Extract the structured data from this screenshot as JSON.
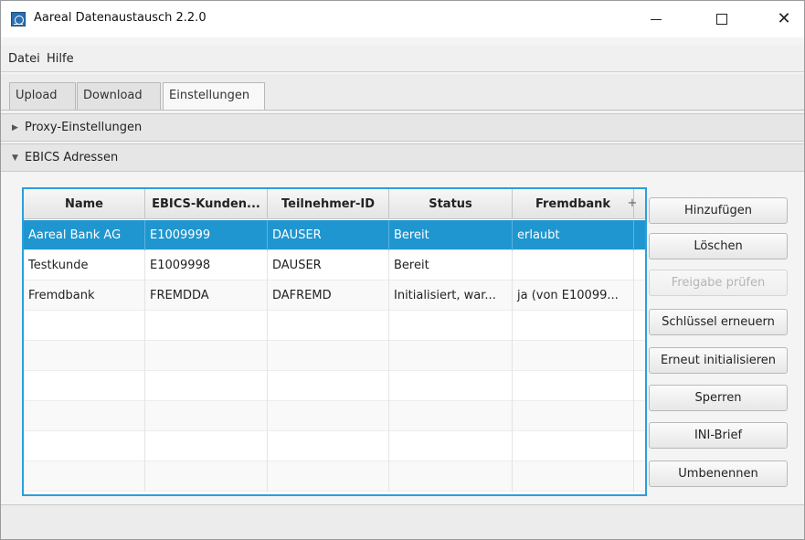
{
  "window": {
    "title": "Aareal Datenaustausch 2.2.0",
    "minimize_glyph": "",
    "maximize_glyph": "",
    "close_glyph": "✕"
  },
  "menu": {
    "items": [
      "Datei",
      "Hilfe"
    ]
  },
  "tabs": [
    {
      "label": "Upload",
      "active": false
    },
    {
      "label": "Download",
      "active": false
    },
    {
      "label": "Einstellungen",
      "active": true
    }
  ],
  "panes": {
    "proxy": {
      "label": "Proxy-Einstellungen",
      "arrow": "▶",
      "expanded": false
    },
    "ebics": {
      "label": "EBICS Adressen",
      "arrow": "▼",
      "expanded": true
    }
  },
  "table": {
    "columns": [
      "Name",
      "EBICS-Kunden...",
      "Teilnehmer-ID",
      "Status",
      "Fremdbank"
    ],
    "add_column_glyph": "+",
    "rows": [
      [
        "Aareal Bank AG",
        "E1009999",
        "DAUSER",
        "Bereit",
        "erlaubt"
      ],
      [
        "Testkunde",
        "E1009998",
        "DAUSER",
        "Bereit",
        ""
      ],
      [
        "Fremdbank",
        "FREMDDA",
        "DAFREMD",
        "Initialisiert, war...",
        "ja (von E10099..."
      ]
    ],
    "selected_row": 0
  },
  "buttons": {
    "add": "Hinzufügen",
    "delete": "Löschen",
    "check_release": "Freigabe prüfen",
    "renew_keys": "Schlüssel erneuern",
    "reinit": "Erneut initialisieren",
    "lock": "Sperren",
    "ini_letter": "INI-Brief",
    "rename": "Umbenennen"
  },
  "colors": {
    "selection": "#1f96cf",
    "focus_border": "#2a9fdc",
    "disabled_text": "#b5b5b5"
  }
}
